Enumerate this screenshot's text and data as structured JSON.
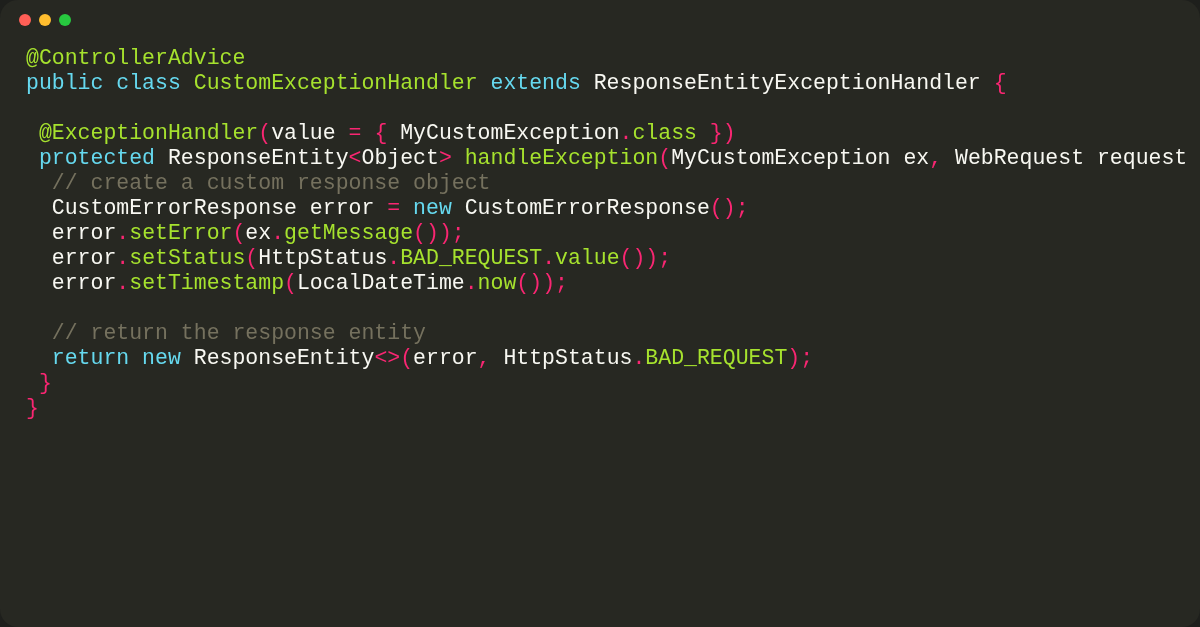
{
  "editor": {
    "lines": [
      {
        "kind": "code",
        "tokens": [
          {
            "kind": "green",
            "text": "@ControllerAdvice"
          }
        ]
      },
      {
        "kind": "code",
        "tokens": [
          {
            "kind": "keyword",
            "text": "public class"
          },
          {
            "kind": "green",
            "text": " CustomExceptionHandler"
          },
          {
            "kind": "keyword",
            "text": " extends"
          },
          {
            "kind": "plain",
            "text": " ResponseEntityExceptionHandler "
          },
          {
            "kind": "punct",
            "text": "{"
          }
        ]
      },
      {
        "kind": "blank"
      },
      {
        "kind": "code",
        "tokens": [
          {
            "kind": "green",
            "text": " @ExceptionHandler"
          },
          {
            "kind": "punct",
            "text": "("
          },
          {
            "kind": "plain",
            "text": "value "
          },
          {
            "kind": "punct",
            "text": "= {"
          },
          {
            "kind": "plain",
            "text": " MyCustomException"
          },
          {
            "kind": "punct",
            "text": "."
          },
          {
            "kind": "green",
            "text": "class"
          },
          {
            "kind": "punct",
            "text": " })"
          }
        ]
      },
      {
        "kind": "code",
        "tokens": [
          {
            "kind": "keyword",
            "text": " protected"
          },
          {
            "kind": "plain",
            "text": " ResponseEntity"
          },
          {
            "kind": "punct",
            "text": "<"
          },
          {
            "kind": "plain",
            "text": "Object"
          },
          {
            "kind": "punct",
            "text": ">"
          },
          {
            "kind": "green",
            "text": " handleException"
          },
          {
            "kind": "punct",
            "text": "("
          },
          {
            "kind": "plain",
            "text": "MyCustomException ex"
          },
          {
            "kind": "punct",
            "text": ","
          },
          {
            "kind": "plain",
            "text": " WebRequest request"
          }
        ]
      },
      {
        "kind": "code",
        "tokens": [
          {
            "kind": "comment",
            "text": "  // create a custom response object"
          }
        ]
      },
      {
        "kind": "code",
        "tokens": [
          {
            "kind": "plain",
            "text": "  CustomErrorResponse error "
          },
          {
            "kind": "punct",
            "text": "="
          },
          {
            "kind": "keyword",
            "text": " new"
          },
          {
            "kind": "plain",
            "text": " CustomErrorResponse"
          },
          {
            "kind": "punct",
            "text": "();"
          }
        ]
      },
      {
        "kind": "code",
        "tokens": [
          {
            "kind": "plain",
            "text": "  error"
          },
          {
            "kind": "punct",
            "text": "."
          },
          {
            "kind": "green",
            "text": "setError"
          },
          {
            "kind": "punct",
            "text": "("
          },
          {
            "kind": "plain",
            "text": "ex"
          },
          {
            "kind": "punct",
            "text": "."
          },
          {
            "kind": "green",
            "text": "getMessage"
          },
          {
            "kind": "punct",
            "text": "());"
          }
        ]
      },
      {
        "kind": "code",
        "tokens": [
          {
            "kind": "plain",
            "text": "  error"
          },
          {
            "kind": "punct",
            "text": "."
          },
          {
            "kind": "green",
            "text": "setStatus"
          },
          {
            "kind": "punct",
            "text": "("
          },
          {
            "kind": "plain",
            "text": "HttpStatus"
          },
          {
            "kind": "punct",
            "text": "."
          },
          {
            "kind": "green",
            "text": "BAD_REQUEST"
          },
          {
            "kind": "punct",
            "text": "."
          },
          {
            "kind": "green",
            "text": "value"
          },
          {
            "kind": "punct",
            "text": "());"
          }
        ]
      },
      {
        "kind": "code",
        "tokens": [
          {
            "kind": "plain",
            "text": "  error"
          },
          {
            "kind": "punct",
            "text": "."
          },
          {
            "kind": "green",
            "text": "setTimestamp"
          },
          {
            "kind": "punct",
            "text": "("
          },
          {
            "kind": "plain",
            "text": "LocalDateTime"
          },
          {
            "kind": "punct",
            "text": "."
          },
          {
            "kind": "green",
            "text": "now"
          },
          {
            "kind": "punct",
            "text": "());"
          }
        ]
      },
      {
        "kind": "blank"
      },
      {
        "kind": "code",
        "tokens": [
          {
            "kind": "comment",
            "text": "  // return the response entity"
          }
        ]
      },
      {
        "kind": "code",
        "tokens": [
          {
            "kind": "keyword",
            "text": "  return new"
          },
          {
            "kind": "plain",
            "text": " ResponseEntity"
          },
          {
            "kind": "punct",
            "text": "<>("
          },
          {
            "kind": "plain",
            "text": "error"
          },
          {
            "kind": "punct",
            "text": ","
          },
          {
            "kind": "plain",
            "text": " HttpStatus"
          },
          {
            "kind": "punct",
            "text": "."
          },
          {
            "kind": "green",
            "text": "BAD_REQUEST"
          },
          {
            "kind": "punct",
            "text": ");"
          }
        ]
      },
      {
        "kind": "code",
        "tokens": [
          {
            "kind": "punct",
            "text": " }"
          }
        ]
      },
      {
        "kind": "code",
        "tokens": [
          {
            "kind": "punct",
            "text": "}"
          }
        ]
      }
    ]
  }
}
